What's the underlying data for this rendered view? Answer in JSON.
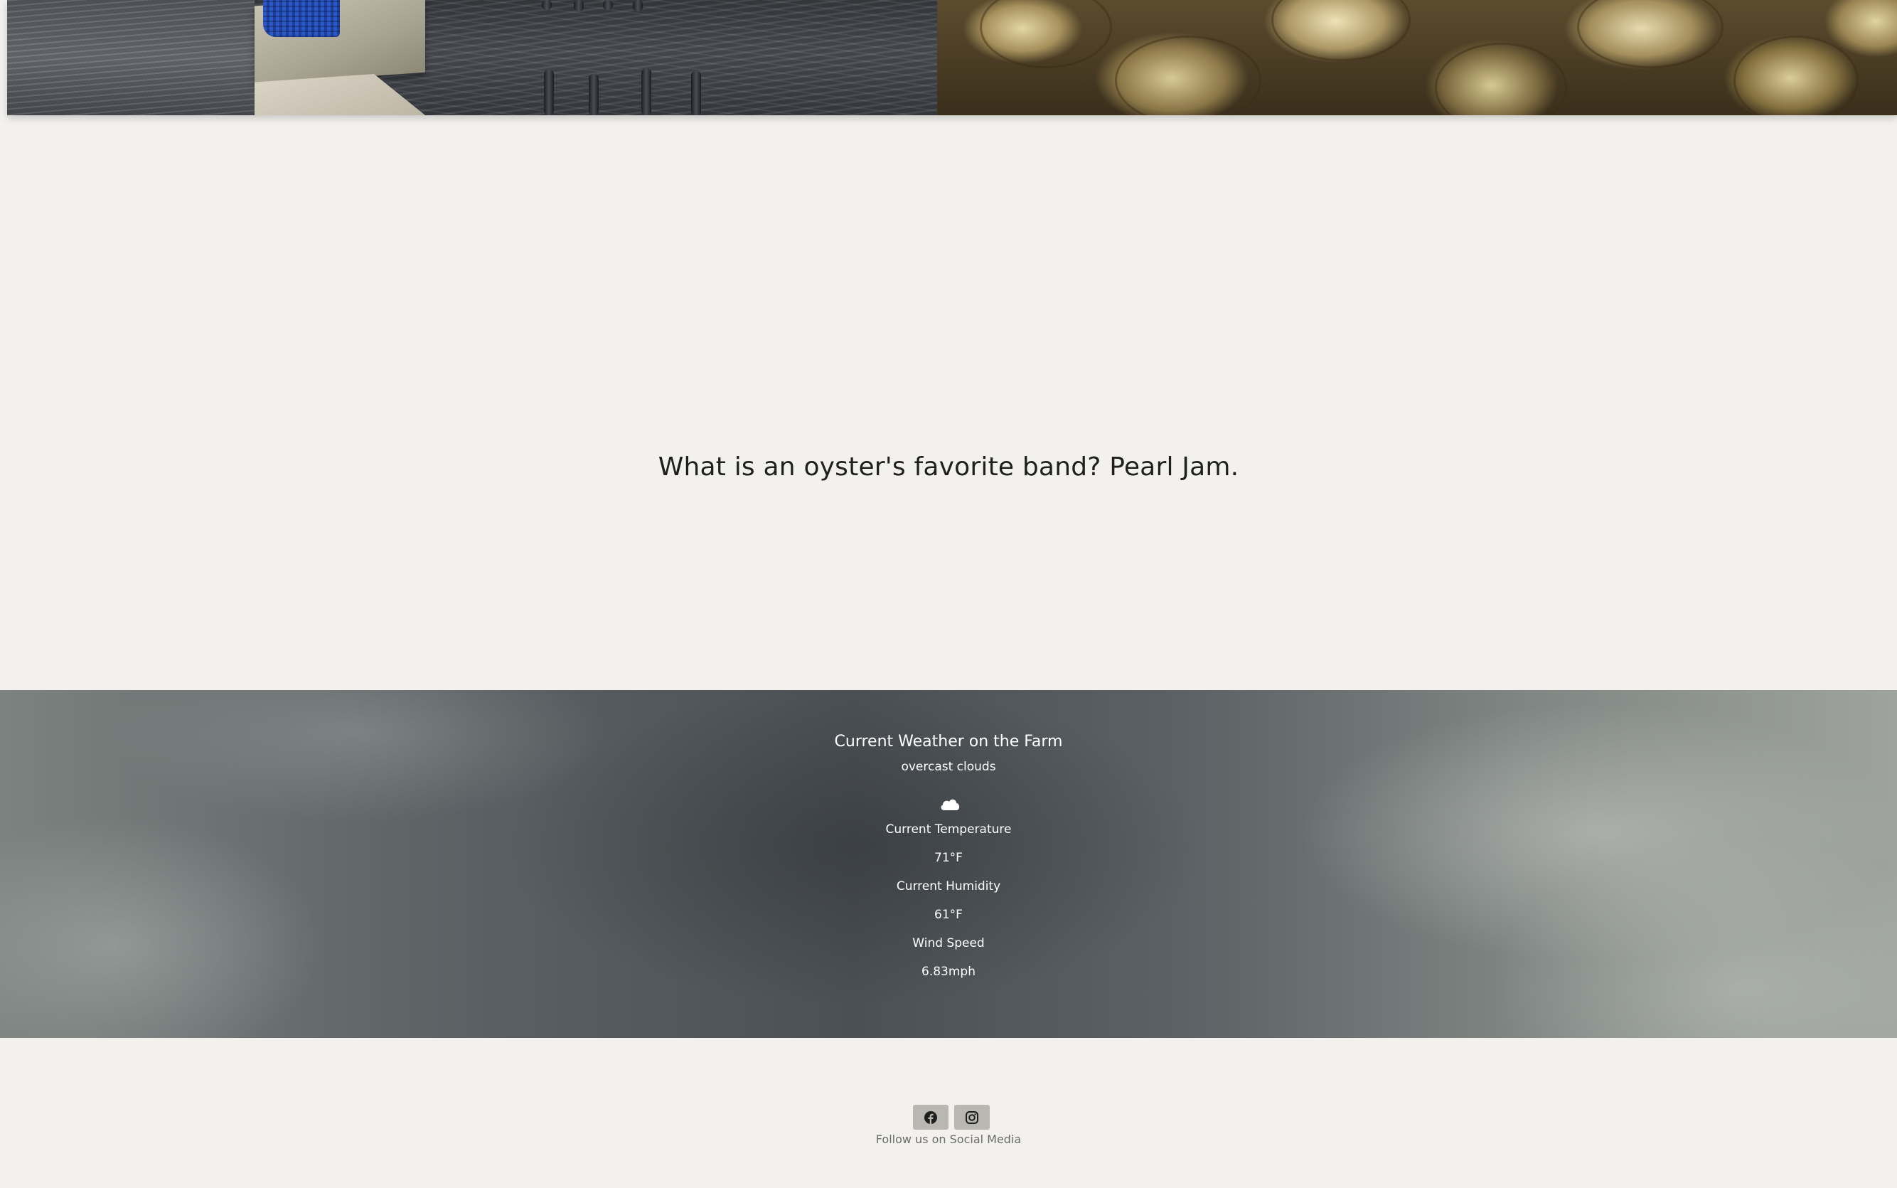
{
  "joke": {
    "text": "What is an oyster's favorite band? Pearl Jam."
  },
  "weather": {
    "title": "Current Weather on the Farm",
    "description": "overcast clouds",
    "icon": "cloud-icon",
    "temperature_label": "Current Temperature",
    "temperature_value": "71°F",
    "humidity_label": "Current Humidity",
    "humidity_value": "61°F",
    "wind_label": "Wind Speed",
    "wind_value": "6.83mph"
  },
  "footer": {
    "social": [
      {
        "icon": "facebook-icon"
      },
      {
        "icon": "instagram-icon"
      }
    ],
    "follow_text": "Follow us on Social Media"
  }
}
